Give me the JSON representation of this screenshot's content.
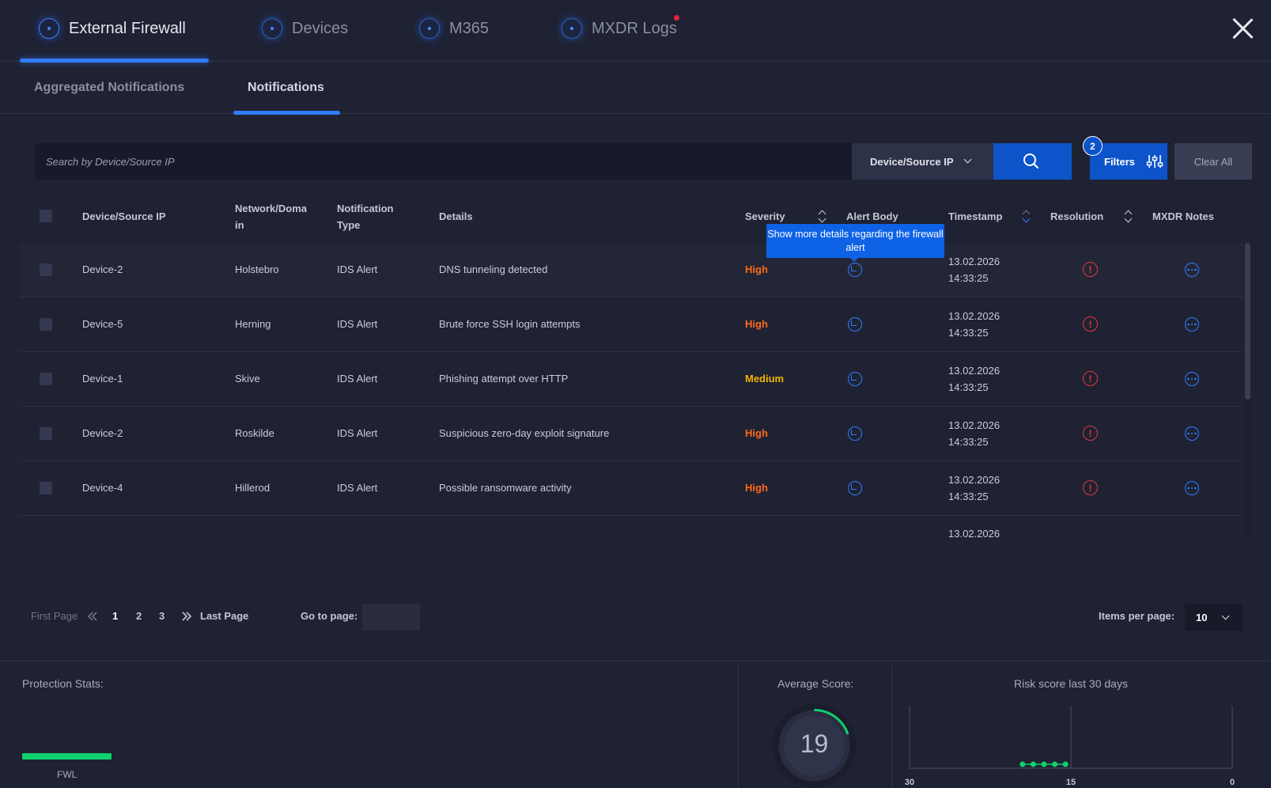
{
  "main_tabs": [
    {
      "label": "External Firewall"
    },
    {
      "label": "Devices"
    },
    {
      "label": "M365"
    },
    {
      "label": "MXDR Logs"
    }
  ],
  "sub_tabs": [
    {
      "label": "Aggregated Notifications"
    },
    {
      "label": "Notifications"
    }
  ],
  "search": {
    "placeholder": "Search by Device/Source IP",
    "field_select": "Device/Source IP",
    "filters_label": "Filters",
    "filters_count": "2",
    "clear_all_label": "Clear All"
  },
  "table": {
    "headers": {
      "device": "Device/Source IP",
      "network": "Network/Doma in",
      "type": "Notification Type",
      "details": "Details",
      "severity": "Severity",
      "alert_body": "Alert Body",
      "timestamp": "Timestamp",
      "resolution": "Resolution",
      "notes": "MXDR Notes"
    },
    "tooltip": "Show more details regarding the firewall alert",
    "rows": [
      {
        "device": "Device-2",
        "network": "Holstebro",
        "type": "IDS Alert",
        "details": "DNS tunneling detected",
        "severity": "High",
        "date": "13.02.2026",
        "time": "14:33:25"
      },
      {
        "device": "Device-5",
        "network": "Herning",
        "type": "IDS Alert",
        "details": "Brute force SSH login attempts",
        "severity": "High",
        "date": "13.02.2026",
        "time": "14:33:25"
      },
      {
        "device": "Device-1",
        "network": "Skive",
        "type": "IDS Alert",
        "details": "Phishing attempt over HTTP",
        "severity": "Medium",
        "date": "13.02.2026",
        "time": "14:33:25"
      },
      {
        "device": "Device-2",
        "network": "Roskilde",
        "type": "IDS Alert",
        "details": "Suspicious zero-day exploit signature",
        "severity": "High",
        "date": "13.02.2026",
        "time": "14:33:25"
      },
      {
        "device": "Device-4",
        "network": "Hillerod",
        "type": "IDS Alert",
        "details": "Possible ransomware activity",
        "severity": "High",
        "date": "13.02.2026",
        "time": "14:33:25"
      }
    ],
    "partial_row_date": "13.02.2026"
  },
  "pagination": {
    "first_label": "First Page",
    "pages": [
      "1",
      "2",
      "3"
    ],
    "current_page": "1",
    "last_label": "Last Page",
    "goto_label": "Go to page:",
    "items_per_page_label": "Items per page:",
    "items_per_page": "10"
  },
  "footer": {
    "protection_title": "Protection Stats:",
    "fwl_label": "FWL",
    "average_title": "Average Score:",
    "average_score": "19",
    "risk_title": "Risk score last 30 days"
  },
  "chart_data": {
    "type": "scatter",
    "title": "Risk score last 30 days",
    "x_ticks": [
      "30",
      "15",
      "0"
    ],
    "x_reversed": true,
    "series": [
      {
        "points": [
          [
            19.5,
            1
          ],
          [
            18.5,
            1
          ],
          [
            17.5,
            1
          ],
          [
            16.5,
            1
          ],
          [
            15.5,
            1
          ]
        ]
      }
    ],
    "color": "#0fd16d"
  },
  "colors": {
    "accent": "#2f7cff",
    "high": "#ff6a1a",
    "medium": "#f4b400",
    "resolution": "#e2383f",
    "fwl_bar": "#0fd16d"
  }
}
